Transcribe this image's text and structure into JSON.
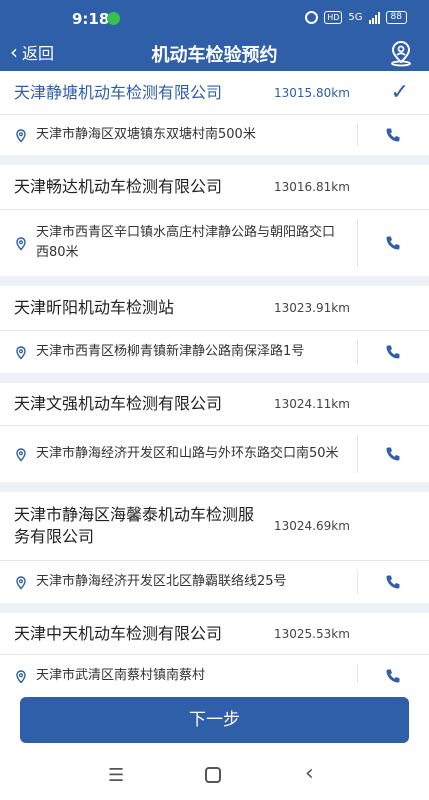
{
  "status_bar": {
    "time": "9:18",
    "network": "5G",
    "battery": "88"
  },
  "header": {
    "back_label": "返回",
    "title": "机动车检验预约",
    "location_icon": "location-person-icon"
  },
  "stations": [
    {
      "name": "天津静塘机动车检测有限公司",
      "distance": "13015.80km",
      "address": "天津市静海区双塘镇东双塘村南500米",
      "selected": true
    },
    {
      "name": "天津畅达机动车检测有限公司",
      "distance": "13016.81km",
      "address": "天津市西青区辛口镇水高庄村津静公路与朝阳路交口西80米",
      "selected": false
    },
    {
      "name": "天津昕阳机动车检测站",
      "distance": "13023.91km",
      "address": "天津市西青区杨柳青镇新津静公路南保泽路1号",
      "selected": false
    },
    {
      "name": "天津文强机动车检测有限公司",
      "distance": "13024.11km",
      "address": "天津市静海经济开发区和山路与外环东路交口南50米",
      "selected": false
    },
    {
      "name": "天津市静海区海馨泰机动车检测服务有限公司",
      "distance": "13024.69km",
      "address": "天津市静海经济开发区北区静霸联络线25号",
      "selected": false
    },
    {
      "name": "天津中天机动车检测有限公司",
      "distance": "13025.53km",
      "address": "天津市武清区南蔡村镇南蔡村",
      "selected": false
    }
  ],
  "footer": {
    "next_label": "下一步"
  },
  "colors": {
    "primary": "#2e5fa8",
    "background": "#eef1f5"
  }
}
